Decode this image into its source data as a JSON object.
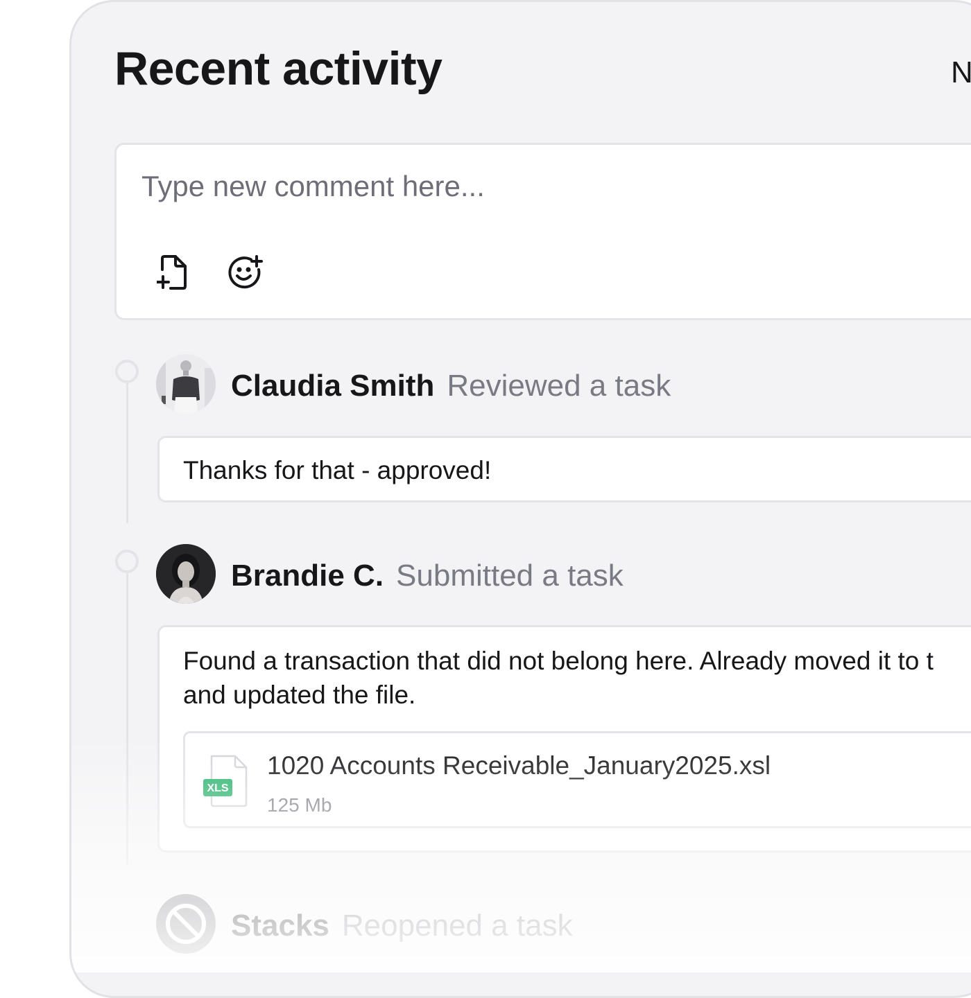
{
  "header": {
    "title": "Recent activity",
    "right_label": "N"
  },
  "composer": {
    "placeholder": "Type new comment here...",
    "attach_icon": "file-plus-icon",
    "emoji_icon": "emoji-add-icon"
  },
  "activity": [
    {
      "name": "Claudia Smith",
      "action": "Reviewed a task",
      "comment_lines": [
        "Thanks for that - approved!"
      ]
    },
    {
      "name": "Brandie C.",
      "action": "Submitted a task",
      "comment_lines": [
        "Found a transaction that did not belong here. Already moved it to t",
        "and updated the file."
      ],
      "attachment": {
        "file_type": "XLS",
        "file_name": "1020 Accounts Receivable_January2025.xsl",
        "file_size": "125 Mb"
      }
    },
    {
      "name": "Stacks",
      "action": "Reopened a task"
    }
  ],
  "colors": {
    "panel_bg": "#f3f3f5",
    "border": "#e3e3e8",
    "text_primary": "#17171a",
    "text_secondary": "#7a7a84",
    "xls_badge": "#27b26b"
  }
}
